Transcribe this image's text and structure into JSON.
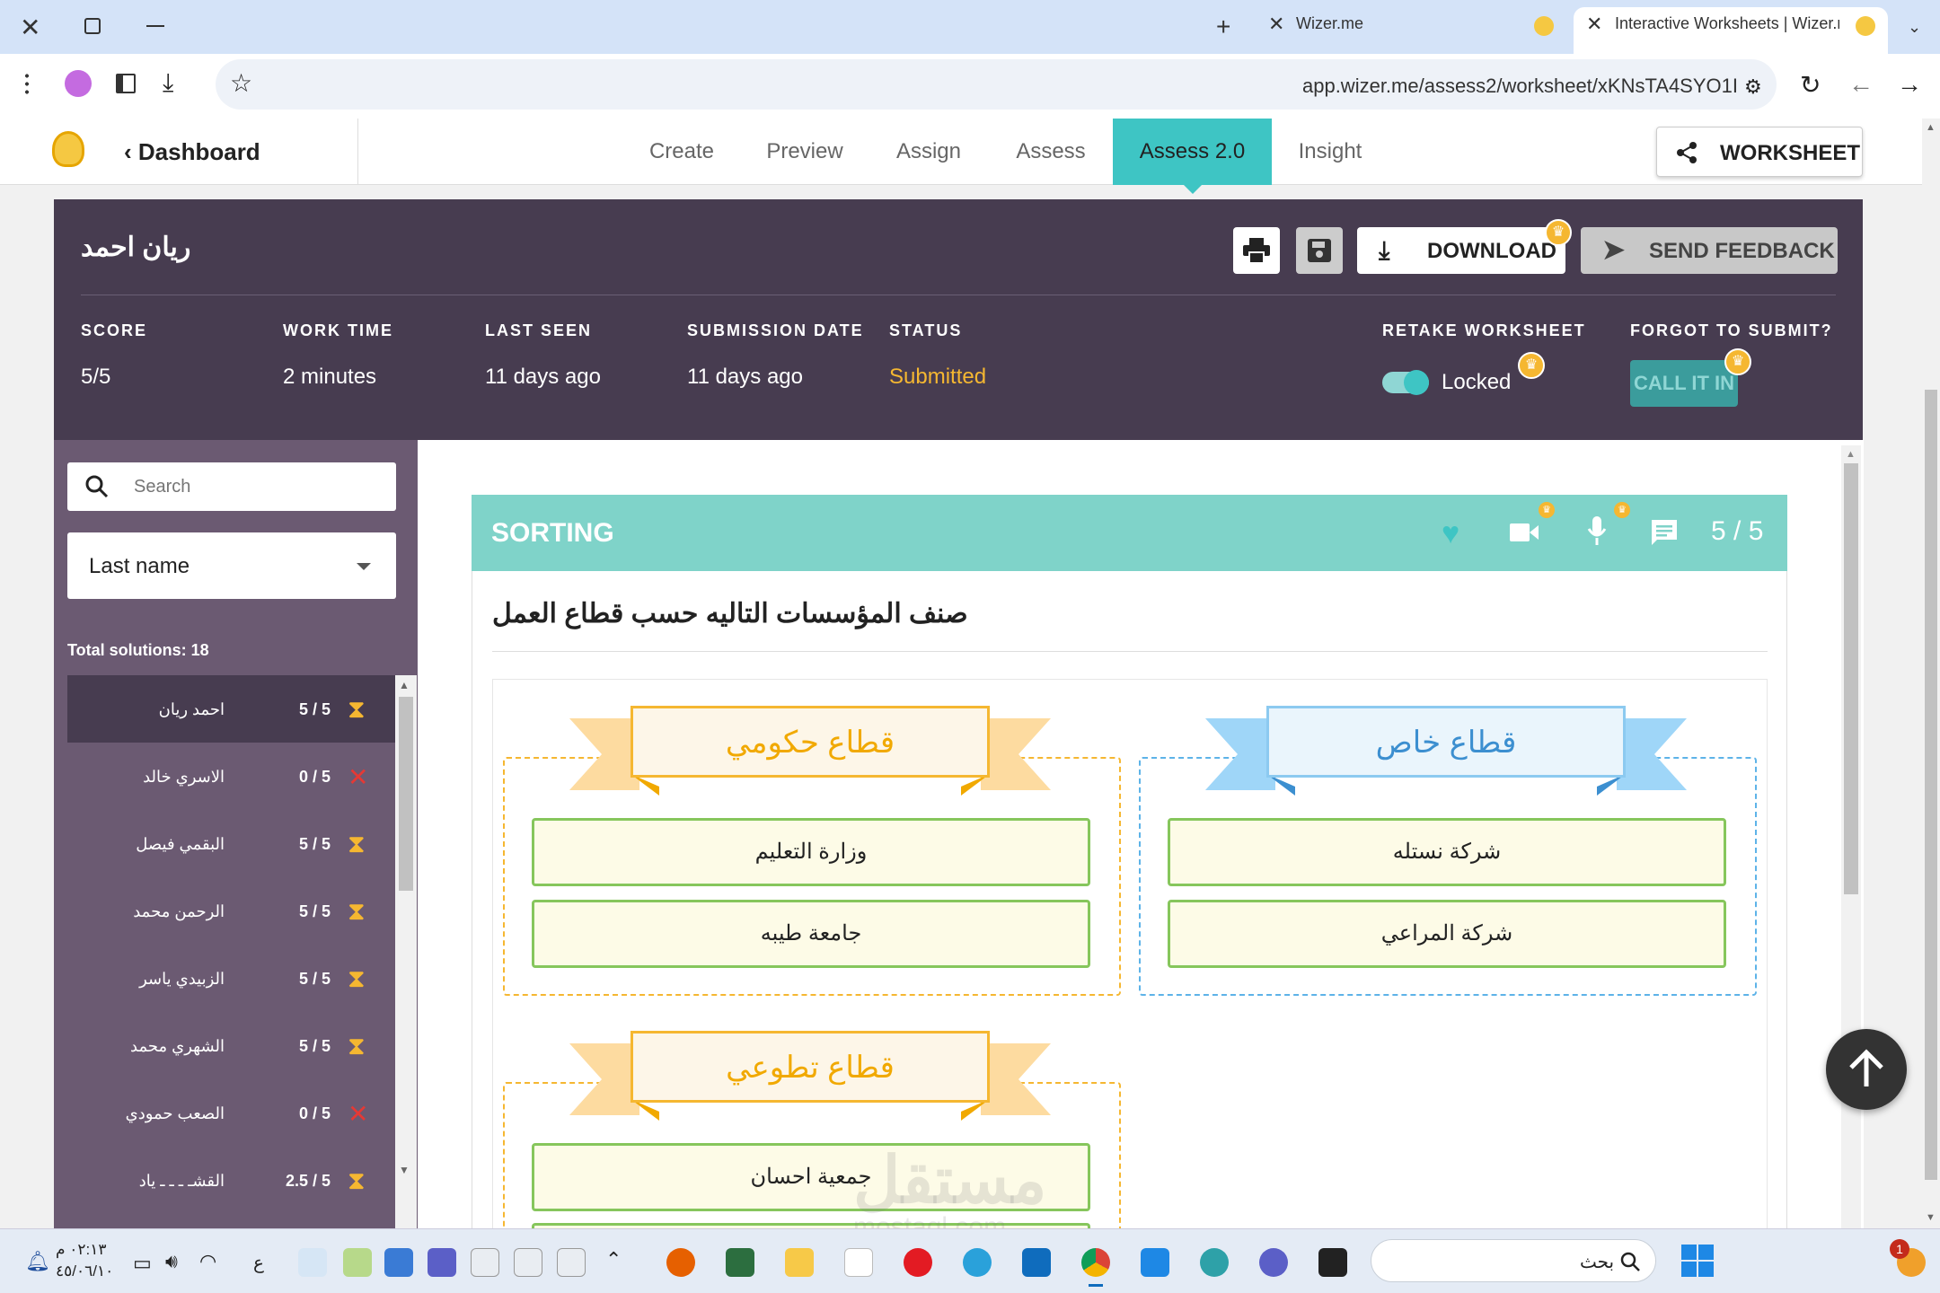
{
  "browser": {
    "tabs": [
      {
        "title": "Wizer.me"
      },
      {
        "title": "Interactive Worksheets | Wizer.r"
      }
    ],
    "url": "app.wizer.me/assess2/worksheet/xKNsTA4SYO1I"
  },
  "app": {
    "back_label": "Dashboard",
    "nav": [
      "Create",
      "Preview",
      "Assign",
      "Assess",
      "Assess 2.0",
      "Insight"
    ],
    "worksheet_label": "WORKSHEET"
  },
  "student": {
    "name": "ريان احمد",
    "download_label": "DOWNLOAD",
    "feedback_label": "SEND FEEDBACK",
    "stats": [
      {
        "label": "SCORE",
        "value": "5/5"
      },
      {
        "label": "WORK TIME",
        "value": "2 minutes"
      },
      {
        "label": "LAST SEEN",
        "value": "11 days ago"
      },
      {
        "label": "SUBMISSION DATE",
        "value": "11 days ago"
      },
      {
        "label": "STATUS",
        "value": "Submitted"
      }
    ],
    "retake_label": "RETAKE WORKSHEET",
    "retake_state": "Locked",
    "forgot_label": "FORGOT TO SUBMIT?",
    "call_in_label": "CALL IT IN",
    "status_color": "#f5b731"
  },
  "sidebar": {
    "search_placeholder": "Search",
    "sort_value": "Last name",
    "total": "Total solutions: 18",
    "students": [
      {
        "name": "احمد ريان",
        "score": "5 / 5",
        "status": "pending"
      },
      {
        "name": "الاسري خالد",
        "score": "0 / 5",
        "status": "fail"
      },
      {
        "name": "البقمي فيصل",
        "score": "5 / 5",
        "status": "pending"
      },
      {
        "name": "الرحمن محمد",
        "score": "5 / 5",
        "status": "pending"
      },
      {
        "name": "الزبيدي ياسر",
        "score": "5 / 5",
        "status": "pending"
      },
      {
        "name": "الشهري محمد",
        "score": "5 / 5",
        "status": "pending"
      },
      {
        "name": "الصعب حمودي",
        "score": "0 / 5",
        "status": "fail"
      },
      {
        "name": "القشـ ـ ـ ـ ياد",
        "score": "2.5 / 5",
        "status": "pending"
      }
    ]
  },
  "question": {
    "type_label": "SORTING",
    "score": "5 / 5",
    "prompt": "صنف المؤسسات التاليه حسب قطاع العمل",
    "groups": [
      {
        "title": "قطاع خاص",
        "items": [
          "شركة نستله",
          "شركة المراعي"
        ],
        "color": "#5db3e8"
      },
      {
        "title": "قطاع حكومي",
        "items": [
          "وزارة التعليم",
          "جامعة طيبه"
        ],
        "color": "#f5b731"
      },
      {
        "title": "قطاع تطوعي",
        "items": [
          "جمعية احسان"
        ],
        "color": "#f5b731"
      }
    ]
  },
  "watermark": {
    "text": "مستقل",
    "sub": "mostaql.com"
  },
  "taskbar": {
    "time": "٠٢:١٣ م",
    "date": "٤٥/٠٦/١٠",
    "search_label": "بحث",
    "lang": "ع",
    "notification_count": "1"
  }
}
